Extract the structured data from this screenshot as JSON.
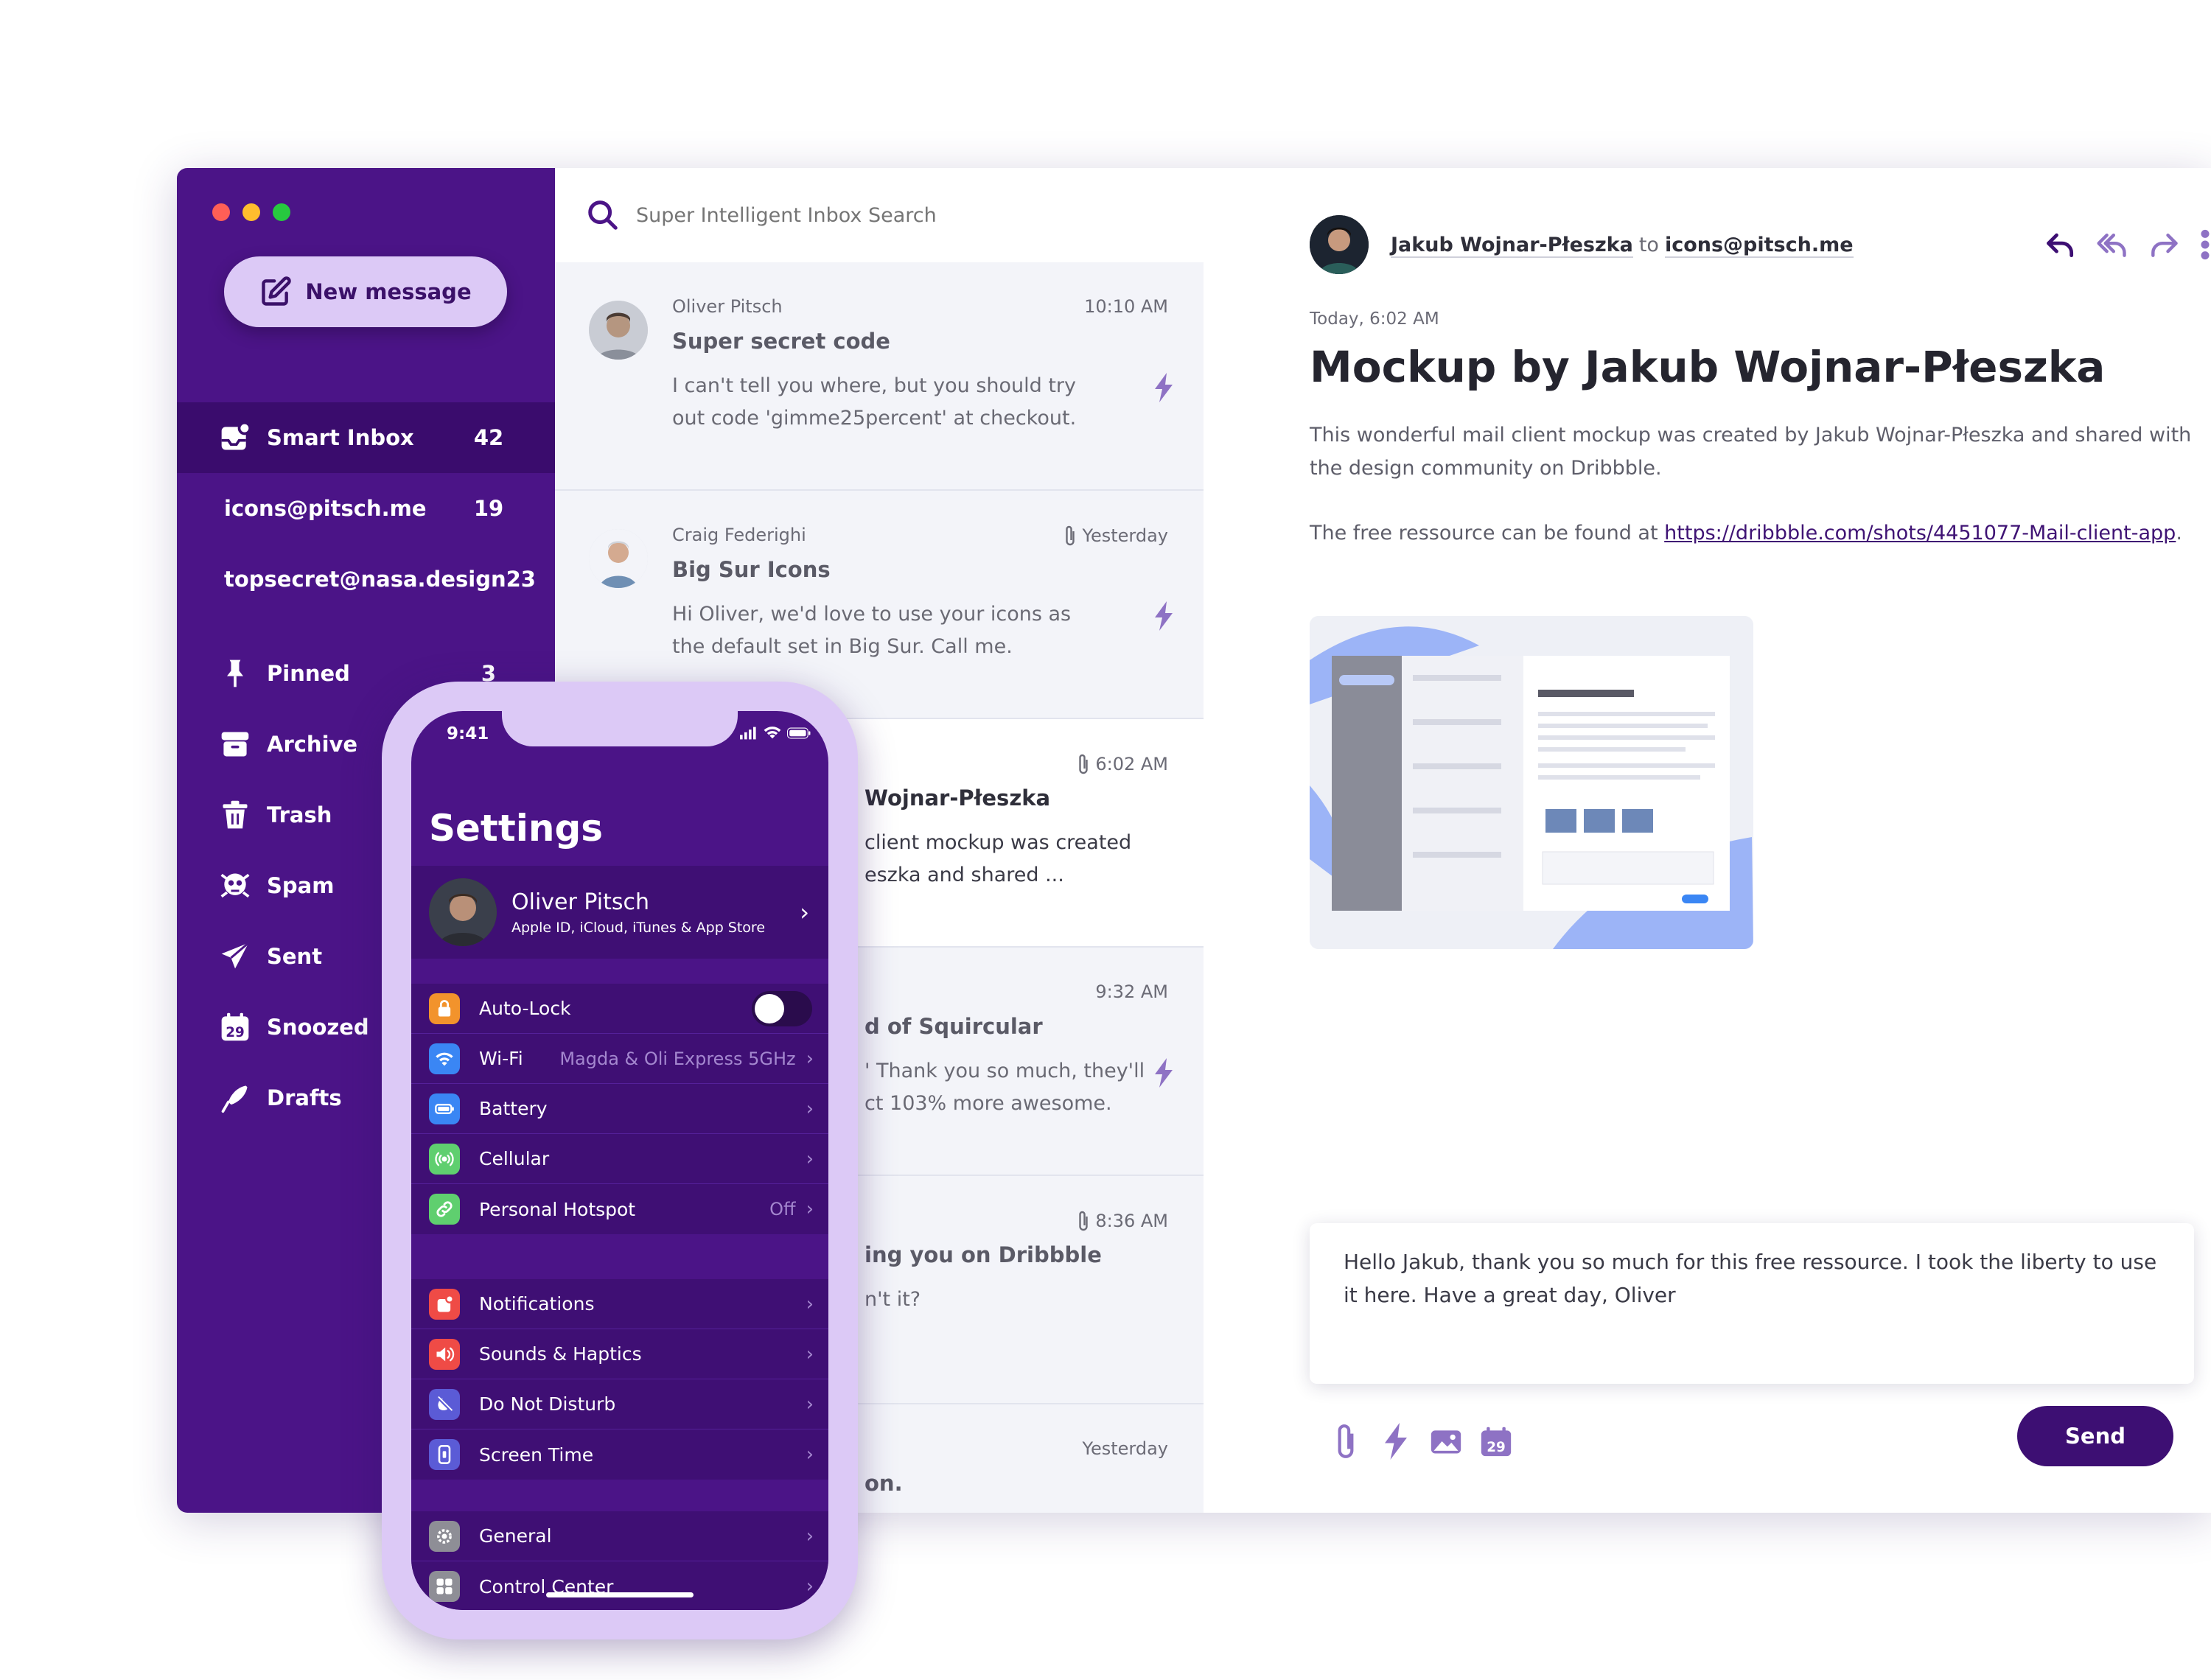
{
  "window": {
    "traffic_colors": [
      "#ff5f56",
      "#ffbd2e",
      "#27c93f"
    ],
    "accent": "#4b1487",
    "accent_dark": "#3a0c6d",
    "accent_light": "#dcc9f6"
  },
  "sidebar": {
    "new_message": "New message",
    "items": [
      {
        "label": "Smart Inbox",
        "count": "42",
        "icon": "inbox-icon",
        "active": true
      },
      {
        "label": "icons@pitsch.me",
        "count": "19"
      },
      {
        "label": "topsecret@nasa.design",
        "count": "23"
      },
      {
        "label": "Pinned",
        "count": "3",
        "icon": "pin-icon"
      },
      {
        "label": "Archive",
        "icon": "archive-icon"
      },
      {
        "label": "Trash",
        "icon": "trash-icon"
      },
      {
        "label": "Spam",
        "icon": "spam-icon"
      },
      {
        "label": "Sent",
        "icon": "sent-icon"
      },
      {
        "label": "Snoozed",
        "icon": "snoozed-icon"
      },
      {
        "label": "Drafts",
        "icon": "drafts-icon"
      }
    ]
  },
  "search": {
    "placeholder": "Super Intelligent Inbox Search"
  },
  "mails": [
    {
      "from": "Oliver Pitsch",
      "time": "10:10 AM",
      "subject": "Super secret code",
      "preview": "I can't tell you where, but you should try out code 'gimme25percent' at checkout."
    },
    {
      "from": "Craig Federighi",
      "time": "Yesterday",
      "subject": "Big Sur Icons",
      "preview": "Hi Oliver, we'd love to use your icons as the default set in Big Sur. Call me."
    },
    {
      "from": "",
      "time": "6:02 AM",
      "subject": "Wojnar-Płeszka",
      "preview": "client mockup was created\neszka and shared ..."
    },
    {
      "from": "",
      "time": "9:32 AM",
      "subject": "d of Squircular",
      "preview": "' Thank you so much, they'll\nct 103% more awesome."
    },
    {
      "from": "",
      "time": "8:36 AM",
      "subject": "ing you on Dribbble",
      "preview": "n't it?"
    },
    {
      "from": "",
      "time": "Yesterday",
      "subject": "on.",
      "preview": ""
    }
  ],
  "reader": {
    "sender_name": "Jakub Wojnar-Płeszka",
    "to_word": "to",
    "recipient": "icons@pitsch.me",
    "date": "Today, 6:02 AM",
    "title": "Mockup by Jakub Wojnar-Płeszka",
    "body1": "This wonderful mail client mockup was created by Jakub Wojnar-Płeszka and shared with the design community on Dribbble.",
    "body2_prefix": "The free ressource can be found at ",
    "link": "https://dribbble.com/shots/4451077-Mail-client-app",
    "body2_suffix": ".",
    "reply_text": "Hello Jakub, thank you so much for this free ressource. I took the liberty to use it here. Have a great day, Oliver",
    "send": "Send"
  },
  "phone": {
    "time": "9:41",
    "title": "Settings",
    "profile_name": "Oliver Pitsch",
    "profile_sub": "Apple ID, iCloud, iTunes & App Store",
    "group1": [
      {
        "label": "Auto-Lock",
        "value": "",
        "icon": "lock-icon",
        "color": "#f2932c",
        "toggle": true
      },
      {
        "label": "Wi-Fi",
        "value": "Magda & Oli Express 5GHz",
        "icon": "wifi-icon",
        "color": "#3a86f4"
      },
      {
        "label": "Battery",
        "value": "",
        "icon": "battery-icon",
        "color": "#3a86f4"
      },
      {
        "label": "Cellular",
        "value": "",
        "icon": "cellular-icon",
        "color": "#5fcf6f"
      },
      {
        "label": "Personal Hotspot",
        "value": "Off",
        "icon": "hotspot-icon",
        "color": "#5fcf6f"
      }
    ],
    "group2": [
      {
        "label": "Notifications",
        "value": "",
        "icon": "notifications-icon",
        "color": "#ef4b46"
      },
      {
        "label": "Sounds & Haptics",
        "value": "",
        "icon": "sound-icon",
        "color": "#ef4b46"
      },
      {
        "label": "Do Not Disturb",
        "value": "",
        "icon": "moon-icon",
        "color": "#5b5bd6"
      },
      {
        "label": "Screen Time",
        "value": "",
        "icon": "hourglass-icon",
        "color": "#5b5bd6"
      }
    ],
    "group3": [
      {
        "label": "General",
        "value": "",
        "icon": "gear-icon",
        "color": "#8e8e96"
      },
      {
        "label": "Control Center",
        "value": "",
        "icon": "control-center-icon",
        "color": "#8e8e96"
      }
    ]
  }
}
